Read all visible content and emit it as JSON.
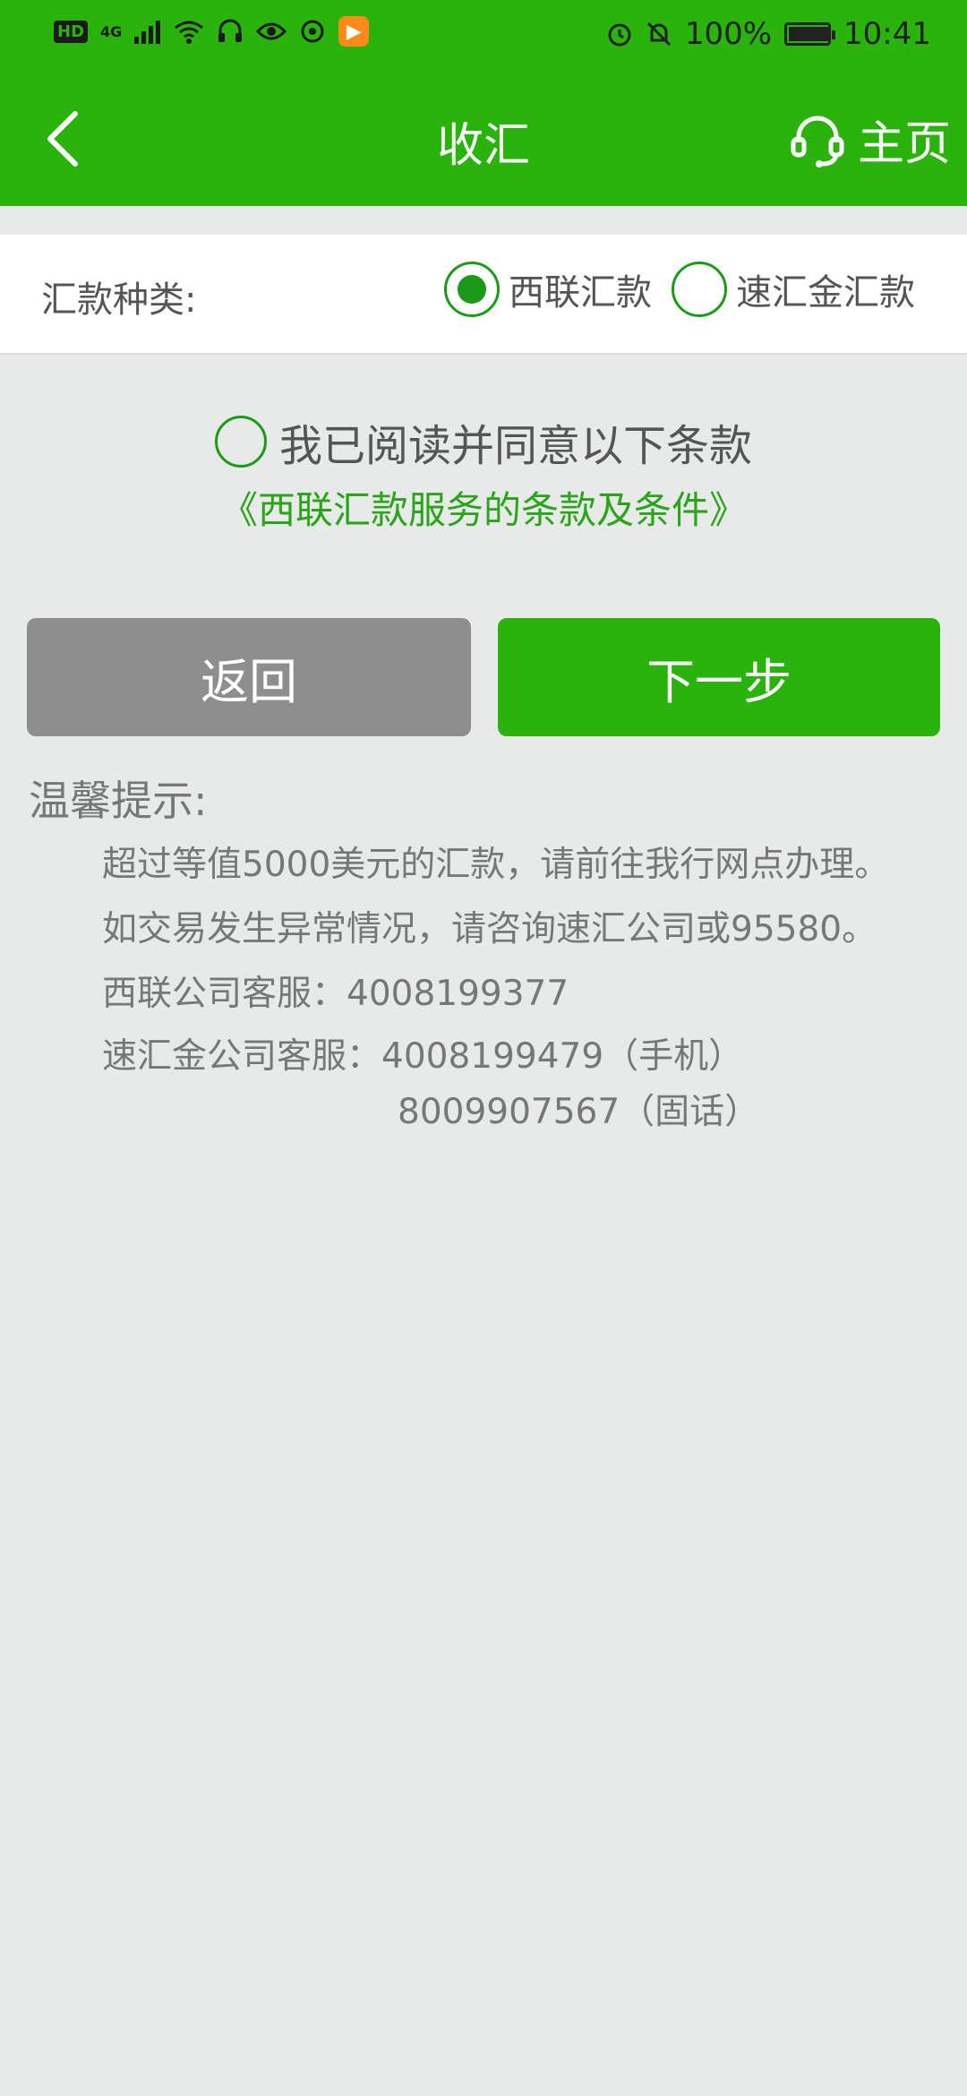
{
  "status_bar": {
    "hd": "HD",
    "network": "4G",
    "battery": "100%",
    "time": "10:41"
  },
  "header": {
    "title": "收汇",
    "home_label": "主页"
  },
  "remit_type": {
    "label": "汇款种类:",
    "options": [
      {
        "label": "西联汇款",
        "selected": true
      },
      {
        "label": "速汇金汇款",
        "selected": false
      }
    ]
  },
  "agreement": {
    "checkbox_label": "我已阅读并同意以下条款",
    "terms_link": "《西联汇款服务的条款及条件》",
    "checked": false
  },
  "buttons": {
    "back": "返回",
    "next": "下一步"
  },
  "tips": {
    "title": "温馨提示:",
    "lines": [
      "超过等值5000美元的汇款，请前往我行网点办理。",
      "如交易发生异常情况，请咨询速汇公司或95580。",
      "西联公司客服：4008199377",
      "速汇金公司客服：4008199479（手机）",
      "8009907567（固话）"
    ]
  },
  "colors": {
    "brand_green": "#29b30c",
    "radio_green": "#1a9a17",
    "link_green": "#2aa51a",
    "back_button_gray": "#8e8e8e"
  }
}
